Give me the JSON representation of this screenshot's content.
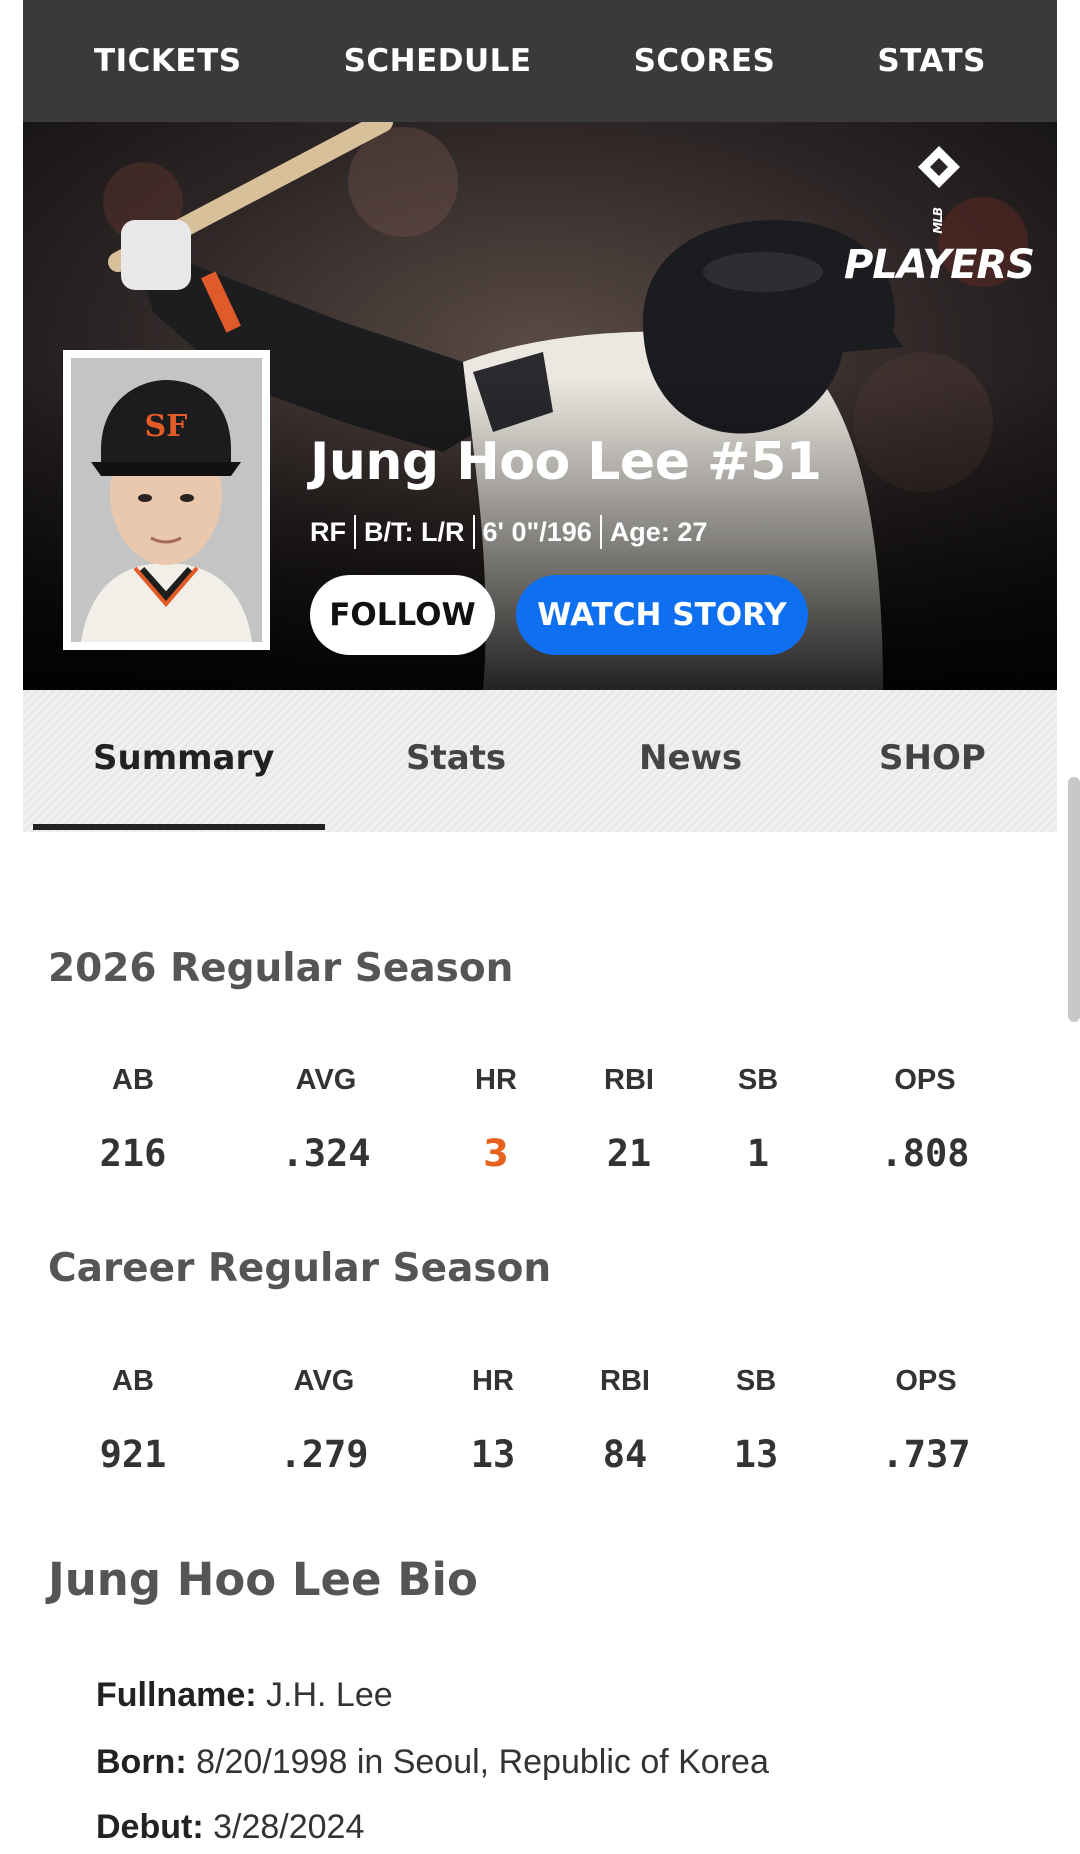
{
  "nav": [
    "TICKETS",
    "SCHEDULE",
    "SCORES",
    "STATS"
  ],
  "brand": {
    "logo_text": "PLAYERS",
    "logo_sub": "MLB"
  },
  "player": {
    "name": "Jung Hoo Lee #51",
    "position": "RF",
    "bats_throws": "B/T: L/R",
    "height_weight": "6' 0\"/196",
    "age": "Age: 27"
  },
  "buttons": {
    "follow": "FOLLOW",
    "watch": "WATCH STORY"
  },
  "tabs": [
    "Summary",
    "Stats",
    "News",
    "SHOP"
  ],
  "season": {
    "title": "2026 Regular Season",
    "headers": [
      "AB",
      "AVG",
      "HR",
      "RBI",
      "SB",
      "OPS"
    ],
    "values": [
      "216",
      ".324",
      "3",
      "21",
      "1",
      ".808"
    ]
  },
  "career": {
    "title": "Career Regular Season",
    "headers": [
      "AB",
      "AVG",
      "HR",
      "RBI",
      "SB",
      "OPS"
    ],
    "values": [
      "921",
      ".279",
      "13",
      "84",
      "13",
      ".737"
    ]
  },
  "bio": {
    "title": "Jung Hoo Lee Bio",
    "rows": [
      {
        "label": "Fullname:",
        "value": "J.H. Lee"
      },
      {
        "label": "Born:",
        "value": "8/20/1998 in Seoul, Republic of Korea"
      },
      {
        "label": "Debut:",
        "value": "3/28/2024"
      }
    ]
  },
  "colors": {
    "nav_bg": "#3a3a3a",
    "accent_blue": "#0e6ff0",
    "highlight_orange": "#e5621f"
  }
}
